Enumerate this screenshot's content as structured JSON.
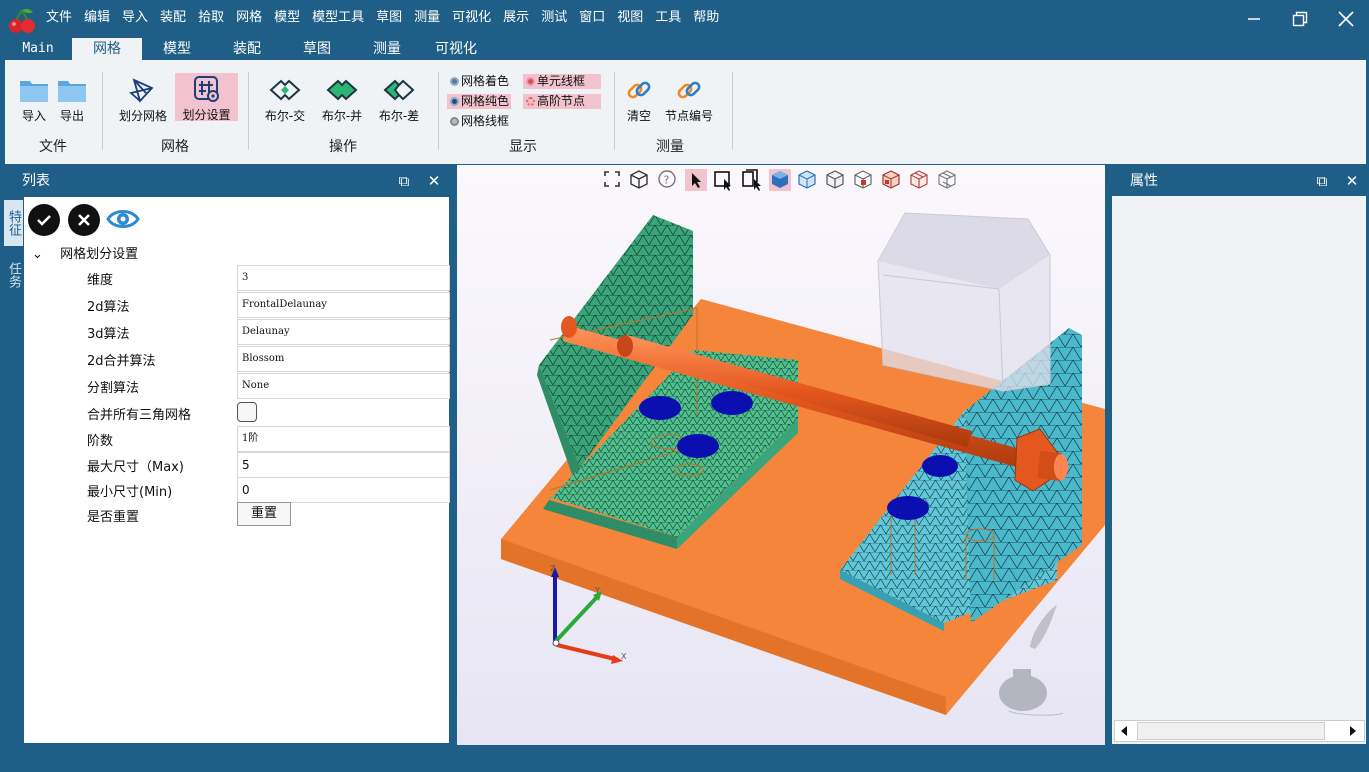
{
  "app": {
    "menu": [
      "文件",
      "编辑",
      "导入",
      "装配",
      "拾取",
      "网格",
      "模型",
      "模型工具",
      "草图",
      "测量",
      "可视化",
      "展示",
      "测试",
      "窗口",
      "视图",
      "工具",
      "帮助"
    ]
  },
  "ribbon_tabs": [
    "Main",
    "网格",
    "模型",
    "装配",
    "草图",
    "测量",
    "可视化"
  ],
  "active_tab": "网格",
  "ribbon": {
    "file": {
      "import": "导入",
      "export": "导出",
      "group": "文件"
    },
    "mesh": {
      "divide": "划分网格",
      "settings": "划分设置",
      "group": "网格"
    },
    "ops": {
      "intersect": "布尔-交",
      "union": "布尔-并",
      "diff": "布尔-差",
      "group": "操作"
    },
    "display": {
      "mesh_color": "网格着色",
      "unit_wire": "单元线框",
      "mesh_solid": "网格纯色",
      "high_nodes": "高阶节点",
      "mesh_wire": "网格线框",
      "group": "显示"
    },
    "measure": {
      "clear": "清空",
      "node_num": "节点编号",
      "group": "测量"
    }
  },
  "left_panel": {
    "title": "列表",
    "vtabs": [
      "特征",
      "任务"
    ]
  },
  "tree": {
    "node": "网格划分设置"
  },
  "props": [
    {
      "label": "维度",
      "value": "3"
    },
    {
      "label": "2d算法",
      "value": "FrontalDelaunay"
    },
    {
      "label": "3d算法",
      "value": "Delaunay"
    },
    {
      "label": "2d合并算法",
      "value": "Blossom"
    },
    {
      "label": "分割算法",
      "value": "None"
    },
    {
      "label": "合并所有三角网格",
      "value": ""
    },
    {
      "label": "阶数",
      "value": "1阶"
    },
    {
      "label": "最大尺寸（Max)",
      "value": "5"
    },
    {
      "label": "最小尺寸(Min)",
      "value": "0"
    },
    {
      "label": "是否重置",
      "value": ""
    }
  ],
  "reset_button": "重置",
  "right_panel": {
    "title": "属性"
  },
  "axes": {
    "x": "X",
    "y": "Y",
    "z": "Z"
  },
  "colors": {
    "titlebar": "#1f5e86",
    "ribbon": "#f0f3f6",
    "selected": "#f2c3cf",
    "plate": "#f4853a",
    "mesh_green": "#3aa57a",
    "mesh_cyan": "#4bb9cc",
    "rod": "#e4571f",
    "pins": "#0b0fb0"
  }
}
